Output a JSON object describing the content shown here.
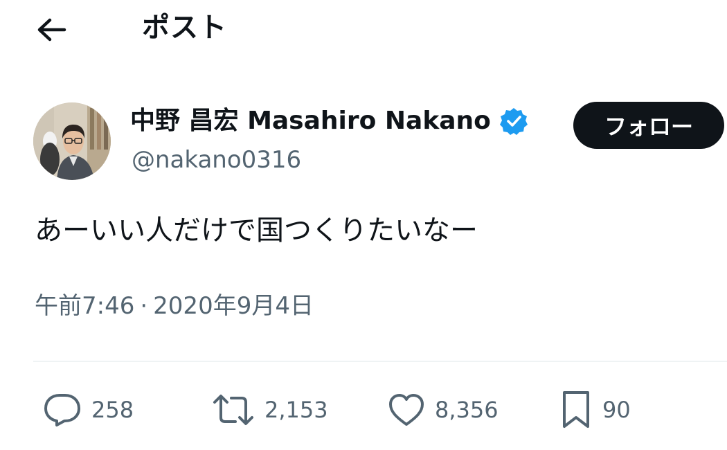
{
  "header": {
    "title": "ポスト",
    "back_icon": "arrow-left-icon"
  },
  "author": {
    "name": "中野 昌宏 Masahiro Nakano",
    "handle": "@nakano0316",
    "verified": true,
    "verified_color": "#1d9bf0",
    "follow_label": "フォロー"
  },
  "tweet": {
    "text": "あーいい人だけで国つくりたいなー",
    "time": "午前7:46",
    "separator": "·",
    "date": "2020年9月4日"
  },
  "actions": {
    "replies": "258",
    "retweets": "2,153",
    "likes": "8,356",
    "bookmarks": "90"
  },
  "colors": {
    "text": "#0f1419",
    "secondary": "#536471",
    "button_bg": "#0f1419",
    "divider": "#eff3f4"
  }
}
